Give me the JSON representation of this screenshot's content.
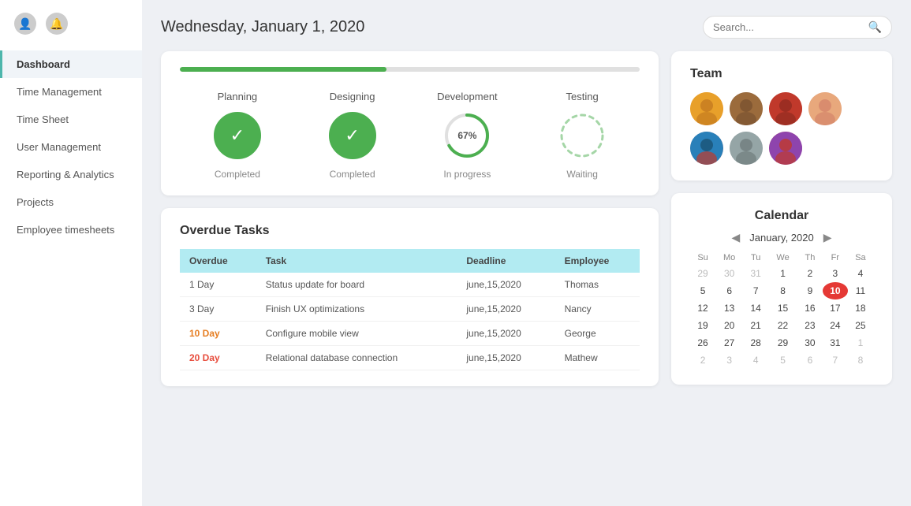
{
  "sidebar": {
    "items": [
      {
        "label": "Dashboard",
        "active": true
      },
      {
        "label": "Time Management",
        "active": false
      },
      {
        "label": "Time Sheet",
        "active": false
      },
      {
        "label": "User Management",
        "active": false
      },
      {
        "label": "Reporting & Analytics",
        "active": false
      },
      {
        "label": "Projects",
        "active": false
      },
      {
        "label": "Employee timesheets",
        "active": false
      }
    ]
  },
  "header": {
    "title": "Wednesday, January 1, 2020",
    "search_placeholder": "Search..."
  },
  "progress": {
    "fill_percent": 45,
    "stages": [
      {
        "name": "Planning",
        "status": "completed",
        "label": "Completed"
      },
      {
        "name": "Designing",
        "status": "completed",
        "label": "Completed"
      },
      {
        "name": "Development",
        "status": "inprogress",
        "label": "In progress",
        "percent": "67%"
      },
      {
        "name": "Testing",
        "status": "waiting",
        "label": "Waiting"
      }
    ]
  },
  "team": {
    "title": "Team",
    "members": [
      {
        "id": 1,
        "class": "av1"
      },
      {
        "id": 2,
        "class": "av2"
      },
      {
        "id": 3,
        "class": "av3"
      },
      {
        "id": 4,
        "class": "av4"
      },
      {
        "id": 5,
        "class": "av5"
      },
      {
        "id": 6,
        "class": "av6"
      },
      {
        "id": 7,
        "class": "av7"
      }
    ]
  },
  "overdue": {
    "title": "Overdue Tasks",
    "columns": [
      "Overdue",
      "Task",
      "Deadline",
      "Employee"
    ],
    "rows": [
      {
        "days": "1  Day",
        "task": "Status update for board",
        "deadline": "june,15,2020",
        "employee": "Thomas",
        "severity": "normal"
      },
      {
        "days": "3  Day",
        "task": "Finish UX optimizations",
        "deadline": "june,15,2020",
        "employee": "Nancy",
        "severity": "normal"
      },
      {
        "days": "10  Day",
        "task": "Configure mobile view",
        "deadline": "june,15,2020",
        "employee": "George",
        "severity": "orange"
      },
      {
        "days": "20  Day",
        "task": "Relational database connection",
        "deadline": "june,15,2020",
        "employee": "Mathew",
        "severity": "red"
      }
    ]
  },
  "calendar": {
    "title": "Calendar",
    "month_label": "January, 2020",
    "day_headers": [
      "Su",
      "Mo",
      "Tu",
      "We",
      "Th",
      "Fr",
      "Sa"
    ],
    "weeks": [
      [
        "29",
        "30",
        "31",
        "1",
        "2",
        "3",
        "4"
      ],
      [
        "5",
        "6",
        "7",
        "8",
        "9",
        "10",
        "11"
      ],
      [
        "12",
        "13",
        "14",
        "15",
        "16",
        "17",
        "18"
      ],
      [
        "19",
        "20",
        "21",
        "22",
        "23",
        "24",
        "25"
      ],
      [
        "26",
        "27",
        "28",
        "29",
        "30",
        "31",
        "1"
      ],
      [
        "2",
        "3",
        "4",
        "5",
        "6",
        "7",
        "8"
      ]
    ],
    "today": "10",
    "other_month_days": [
      "29",
      "30",
      "31",
      "1",
      "2",
      "3",
      "4",
      "5",
      "6",
      "7",
      "8"
    ]
  }
}
